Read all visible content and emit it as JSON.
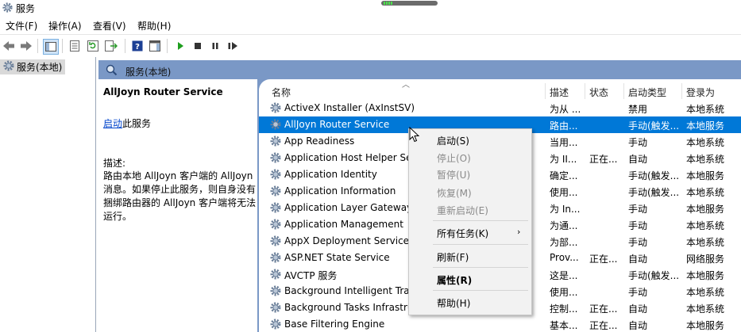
{
  "window": {
    "title": "服务"
  },
  "menu": [
    "文件(F)",
    "操作(A)",
    "查看(V)",
    "帮助(H)"
  ],
  "toolbar": {
    "buttons": [
      "back-icon",
      "forward-icon",
      "show-tree-icon",
      "properties-icon",
      "refresh-icon",
      "export-icon",
      "help-icon",
      "show-action-pane-icon",
      "start-icon",
      "stop-icon",
      "pause-icon",
      "restart-icon"
    ]
  },
  "tree": {
    "item": "服务(本地)"
  },
  "panel": {
    "header": "服务(本地)"
  },
  "detail": {
    "service_name": "AllJoyn Router Service",
    "start_link": "启动",
    "start_suffix": "此服务",
    "desc_label": "描述:",
    "desc_text": "路由本地 AllJoyn 客户端的 AllJoyn 消息。如果停止此服务，则自身没有捆绑路由器的 AllJoyn 客户端将无法运行。"
  },
  "columns": [
    "名称",
    "描述",
    "状态",
    "启动类型",
    "登录为"
  ],
  "rows": [
    {
      "name": "ActiveX Installer (AxInstSV)",
      "desc": "为从 ...",
      "status": "",
      "start": "禁用",
      "logon": "本地系统"
    },
    {
      "name": "AllJoyn Router Service",
      "desc": "路由...",
      "status": "",
      "start": "手动(触发...",
      "logon": "本地服务"
    },
    {
      "name": "App Readiness",
      "desc": "当用...",
      "status": "",
      "start": "手动",
      "logon": "本地系统"
    },
    {
      "name": "Application Host Helper Service",
      "desc": "为 II...",
      "status": "正在...",
      "start": "自动",
      "logon": "本地系统"
    },
    {
      "name": "Application Identity",
      "desc": "确定...",
      "status": "",
      "start": "手动(触发...",
      "logon": "本地服务"
    },
    {
      "name": "Application Information",
      "desc": "使用...",
      "status": "",
      "start": "手动(触发...",
      "logon": "本地系统"
    },
    {
      "name": "Application Layer Gateway Service",
      "desc": "为 In...",
      "status": "",
      "start": "手动",
      "logon": "本地服务"
    },
    {
      "name": "Application Management",
      "desc": "为通...",
      "status": "",
      "start": "手动",
      "logon": "本地系统"
    },
    {
      "name": "AppX Deployment Service (AppXSVC)",
      "desc": "为部...",
      "status": "",
      "start": "手动",
      "logon": "本地系统"
    },
    {
      "name": "ASP.NET State Service",
      "desc": "Prov...",
      "status": "正在...",
      "start": "自动",
      "logon": "网络服务"
    },
    {
      "name": "AVCTP 服务",
      "desc": "这是...",
      "status": "",
      "start": "手动(触发...",
      "logon": "本地服务"
    },
    {
      "name": "Background Intelligent Transfer Service",
      "desc": "使用...",
      "status": "",
      "start": "手动",
      "logon": "本地系统"
    },
    {
      "name": "Background Tasks Infrastructure Service",
      "desc": "控制...",
      "status": "正在...",
      "start": "自动",
      "logon": "本地系统"
    },
    {
      "name": "Base Filtering Engine",
      "desc": "基本...",
      "status": "正在...",
      "start": "自动",
      "logon": "本地服务"
    }
  ],
  "context_menu": {
    "start": "启动(S)",
    "stop": "停止(O)",
    "pause": "暂停(U)",
    "resume": "恢复(M)",
    "restart": "重新启动(E)",
    "all_tasks": "所有任务(K)",
    "refresh": "刷新(F)",
    "properties": "属性(R)",
    "help": "帮助(H)"
  },
  "colors": {
    "selection": "#0078d7",
    "panel_header": "#7a98c6",
    "link": "#0044cc"
  }
}
